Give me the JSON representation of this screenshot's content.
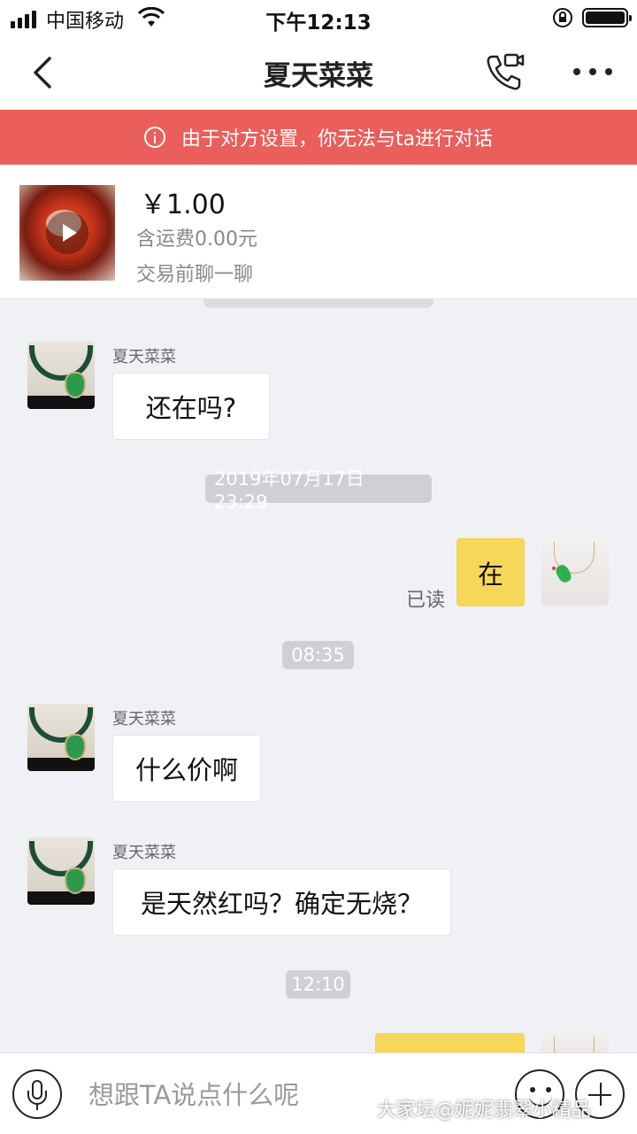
{
  "status_bar": {
    "carrier": "中国移动",
    "time": "下午12:13"
  },
  "nav": {
    "title": "夏天菜菜"
  },
  "banner": {
    "text": "由于对方设置，你无法与ta进行对话"
  },
  "product": {
    "price": "￥1.00",
    "shipping": "含运费0.00元",
    "note": "交易前聊一聊"
  },
  "messages": [
    {
      "sender": "夏天菜菜",
      "text": "还在吗?"
    },
    {
      "time": "2019年07月17日 23:29"
    },
    {
      "from_me": true,
      "text": "在",
      "status": "已读"
    },
    {
      "time": "08:35"
    },
    {
      "sender": "夏天菜菜",
      "text": "什么价啊"
    },
    {
      "sender": "夏天菜菜",
      "text": "是天然红吗？确定无烧？"
    },
    {
      "time": "12:10"
    }
  ],
  "input": {
    "placeholder": "想跟TA说点什么呢"
  },
  "watermark": "大家坛@妮妮翡翠小精品",
  "colors": {
    "banner_bg": "#ea5e5b",
    "my_bubble": "#f7d75a",
    "chat_bg": "#f0f1f5"
  }
}
